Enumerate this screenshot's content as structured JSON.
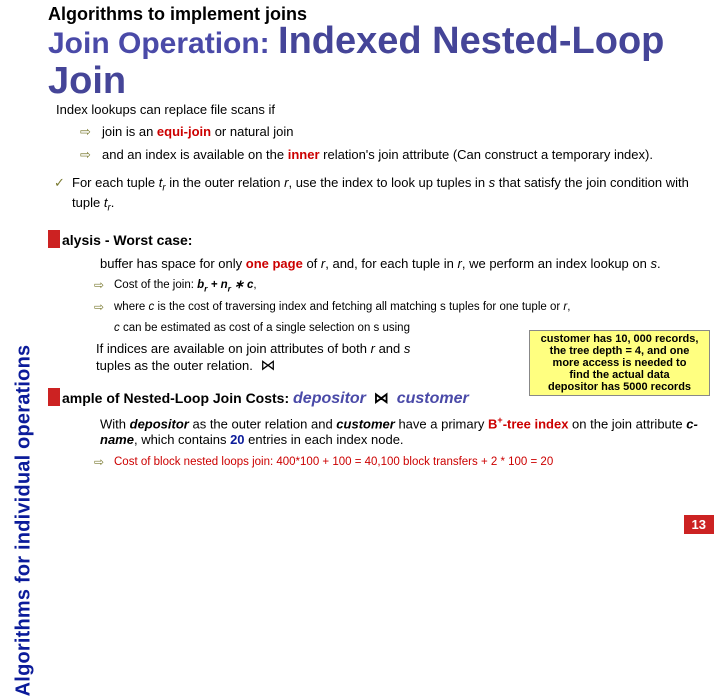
{
  "sidebar": {
    "label": "Algorithms for individual operations"
  },
  "topline": "Algorithms to implement joins",
  "title": {
    "pre": "Join Operation:",
    "big": "Indexed Nested-Loop Join"
  },
  "body": {
    "l0": "Index lookups can replace file scans if",
    "l1a": "join is an ",
    "l1b": "equi-join",
    "l1c": " or natural join",
    "l2a": "and an index is available on the ",
    "l2b": "inner",
    "l2c": " relation's join attribute (Can construct a temporary index).",
    "l3a": "For each tuple ",
    "l3b": "t",
    "l3br": "r",
    "l3c": " in the outer relation ",
    "l3d": "r",
    "l3e": ", use the index to look up tuples in ",
    "l3f": "s",
    "l3g": " that satisfy the join condition with tuple ",
    "l3h": "t",
    "l3hr": "r",
    "l3i": ".",
    "h1": "alysis - Worst case:",
    "l4a": "buffer has space for only ",
    "l4b": "one page",
    "l4c": " of ",
    "l4d": "r",
    "l4e": ", and, for each tuple in ",
    "l4f": "r",
    "l4g": ", we perform an index lookup on ",
    "l4h": "s",
    "l4i": ".",
    "l5a": "Cost of the join:  ",
    "l5b": "b",
    "l5br": "r",
    "l5c": "  +  n",
    "l5cr": "r",
    "l5d": " ∗ c",
    "l5e": ",",
    "l6a": "where ",
    "l6b": "c",
    "l6c": " is the cost of traversing index and fetching all matching s tuples for one tuple or ",
    "l6d": "r",
    "l6e": ",",
    "l7a": "c",
    "l7b": " can be estimated as cost of a single selection on s using",
    "l8a": "If indices are available on join attributes of both ",
    "l8b": "r",
    "l8c": " and ",
    "l8d": "s",
    "l8e": "    more access is needed to",
    "l8f": "tuples as the outer relation.",
    "h2a": "ample of Nested-Loop Join Costs:",
    "h2b": "depositor",
    "h2c": "customer",
    "l9a": "With ",
    "l9b": "depositor",
    "l9c": " as the outer relation and ",
    "l9d": "customer",
    "l9e": " have a primary ",
    "l9f": "B",
    "l9g": "+",
    "l9h": "-tree index",
    "l9i": " on the join attribute ",
    "l9j": "c-name",
    "l9k": ", which contains ",
    "l9l": "20",
    "l9m": " entries in each index node.",
    "lcut": "Cost of block nested loops join: 400*100 + 100 = 40,100 block transfers + 2 * 100 = 20"
  },
  "yellow": {
    "l1": "customer has 10, 000 records,",
    "l2": "the tree depth = 4, and one",
    "l3": "more access is needed to",
    "l4": "find the actual data",
    "l5": "depositor has 5000 records"
  },
  "footer": {
    "num": "13"
  },
  "join_symbol": "⋈"
}
